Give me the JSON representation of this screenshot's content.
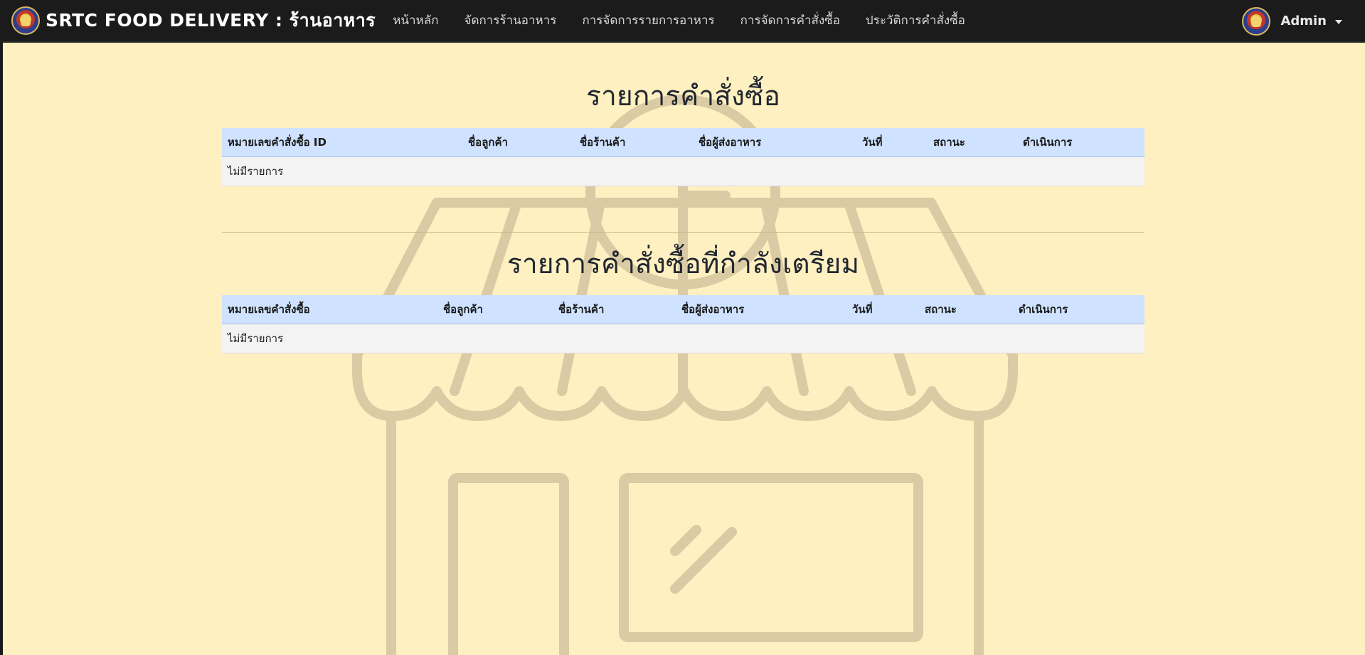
{
  "navbar": {
    "brand": "SRTC FOOD DELIVERY : ร้านอาหาร",
    "links": [
      "หน้าหลัก",
      "จัดการร้านอาหาร",
      "การจัดการรายการอาหาร",
      "การจัดการคำสั่งซื้อ",
      "ประวัติการคำสั่งซื้อ"
    ],
    "user": "Admin"
  },
  "orders": {
    "title": "รายการคำสั่งซื้อ",
    "headers": [
      "หมายเลขคำสั่งซื้อ ID",
      "ชื่อลูกค้า",
      "ชื่อร้านค้า",
      "ชื่อผู้ส่งอาหาร",
      "วันที่",
      "สถานะ",
      "ดำเนินการ"
    ],
    "empty": "ไม่มีรายการ"
  },
  "preparing": {
    "title": "รายการคำสั่งซื้อที่กำลังเตรียม",
    "headers": [
      "หมายเลขคำสั่งซื้อ",
      "ชื่อลูกค้า",
      "ชื่อร้านค้า",
      "ชื่อผู้ส่งอาหาร",
      "วันที่",
      "สถานะ",
      "ดำเนินการ"
    ],
    "empty": "ไม่มีรายการ"
  },
  "colors": {
    "navbar": "#1b1b1b",
    "background": "#fff0c1",
    "table_header": "#cfe2ff",
    "illustration": "#d9cba3"
  },
  "icons": {
    "logo": "college-seal-icon",
    "background": "storefront-icon"
  }
}
